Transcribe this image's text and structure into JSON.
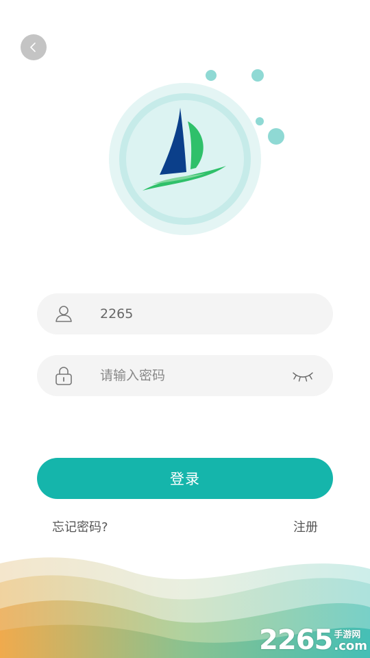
{
  "username": {
    "value": "2265"
  },
  "password": {
    "placeholder": "请输入密码"
  },
  "actions": {
    "login_label": "登录",
    "forgot_label": "忘记密码?",
    "register_label": "注册"
  },
  "watermark": {
    "main": "2265",
    "cn": "手游网",
    "domain": ".com"
  },
  "colors": {
    "accent": "#15b5ab",
    "field_bg": "#f4f4f4",
    "logo_navy": "#0b3f8a",
    "logo_green": "#2fc06a",
    "bubble": "#8fd9d4"
  },
  "icons": {
    "back": "chevron-left-icon",
    "user": "user-icon",
    "lock": "lock-icon",
    "eye": "eye-closed-icon"
  }
}
